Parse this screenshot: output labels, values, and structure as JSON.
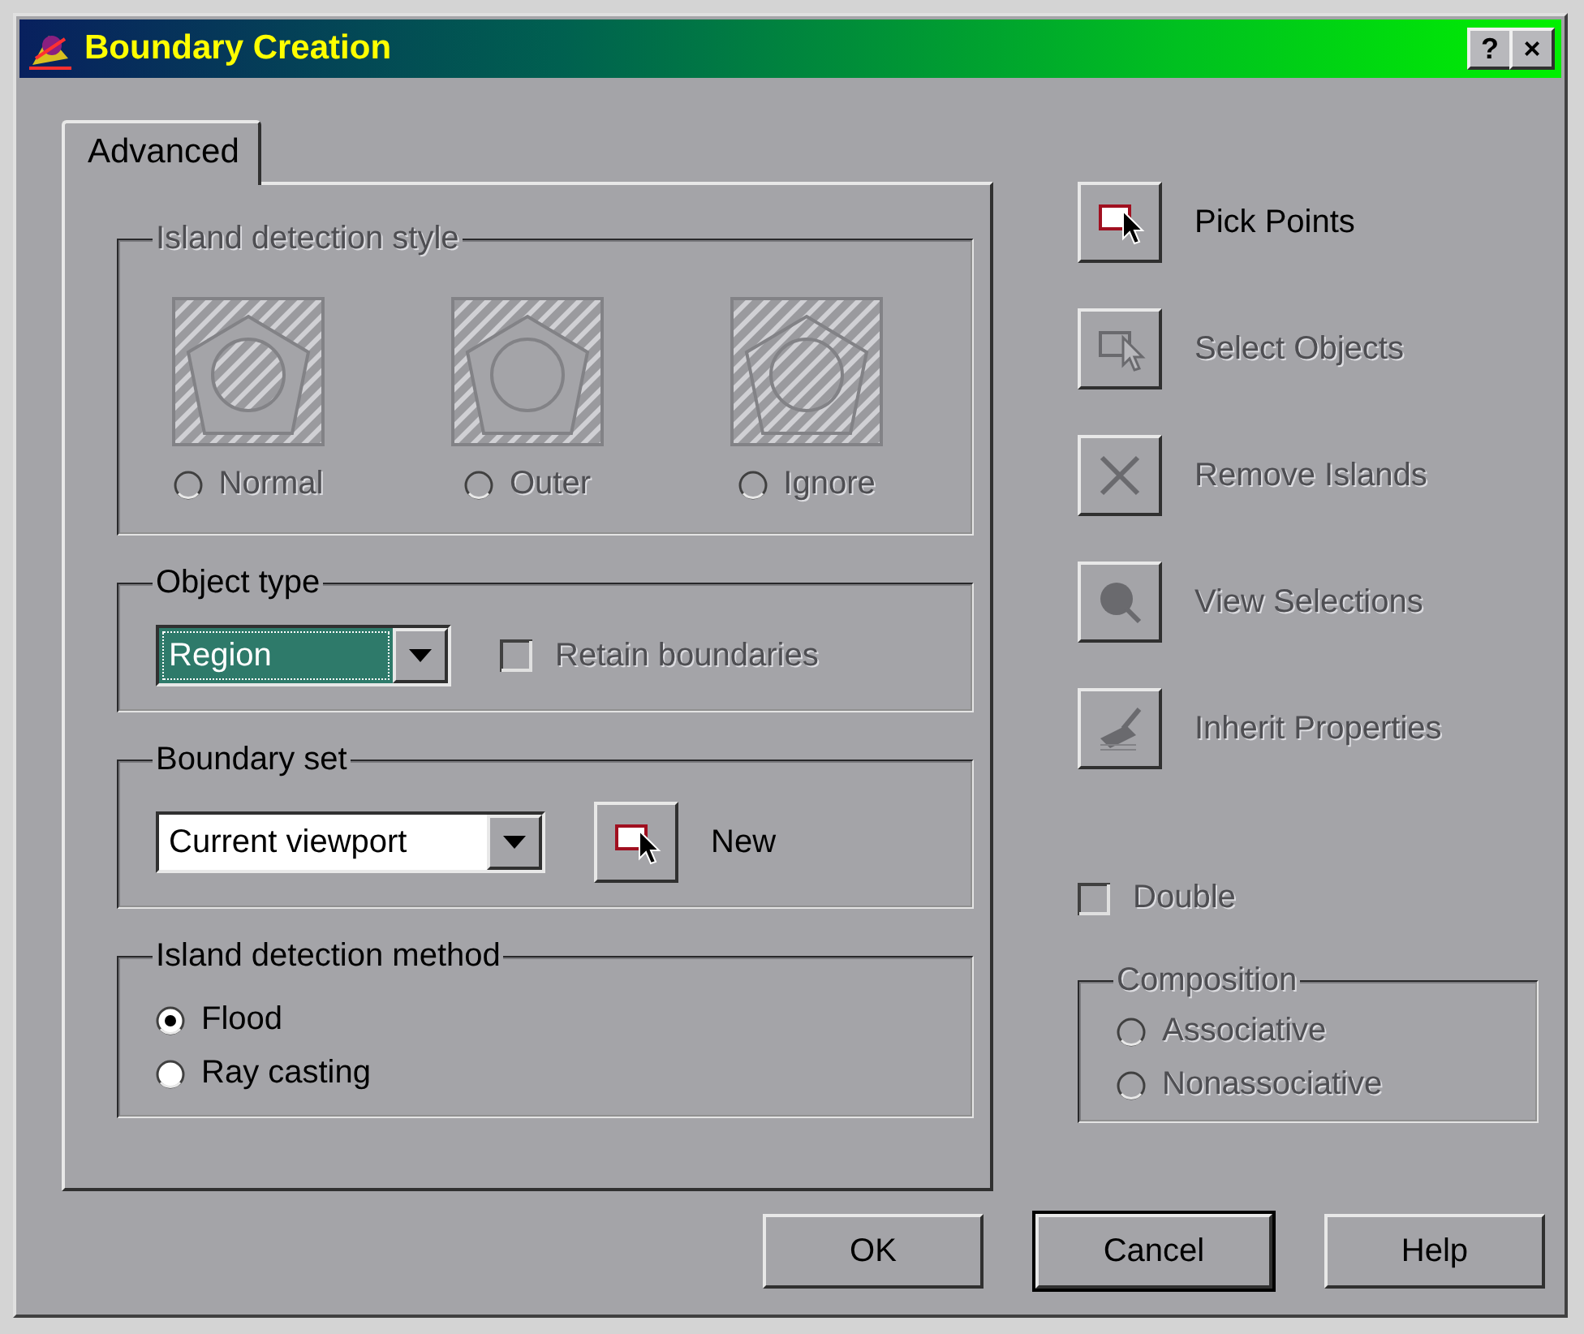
{
  "window": {
    "title": "Boundary Creation",
    "help_button": "?",
    "close_button": "×"
  },
  "tabs": [
    {
      "label": "Advanced",
      "selected": true
    }
  ],
  "island_detection_style": {
    "title": "Island detection style",
    "disabled": true,
    "options": [
      {
        "kind": "normal",
        "label": "Normal",
        "selected": false
      },
      {
        "kind": "outer",
        "label": "Outer",
        "selected": false
      },
      {
        "kind": "ignore",
        "label": "Ignore",
        "selected": false
      }
    ]
  },
  "object_type": {
    "title": "Object type",
    "dropdown": {
      "value": "Region",
      "focused": true
    },
    "retain_boundaries": {
      "label": "Retain boundaries",
      "checked": false,
      "disabled": true
    }
  },
  "boundary_set": {
    "title": "Boundary set",
    "dropdown": {
      "value": "Current viewport",
      "focused": false
    },
    "new_label": "New"
  },
  "island_detection_method": {
    "title": "Island detection method",
    "disabled": false,
    "options": [
      {
        "label": "Flood",
        "selected": true
      },
      {
        "label": "Ray casting",
        "selected": false
      }
    ]
  },
  "actions": [
    {
      "kind": "pick",
      "label": "Pick Points",
      "disabled": false
    },
    {
      "kind": "select",
      "label": "Select Objects",
      "disabled": true
    },
    {
      "kind": "remove",
      "label": "Remove Islands",
      "disabled": true
    },
    {
      "kind": "view",
      "label": "View Selections",
      "disabled": true
    },
    {
      "kind": "inherit",
      "label": "Inherit Properties",
      "disabled": true
    }
  ],
  "double": {
    "label": "Double",
    "checked": false,
    "disabled": true
  },
  "composition": {
    "title": "Composition",
    "disabled": true,
    "options": [
      {
        "label": "Associative",
        "selected": false
      },
      {
        "label": "Nonassociative",
        "selected": false
      }
    ]
  },
  "buttons": [
    {
      "label": "OK",
      "default": false
    },
    {
      "label": "Cancel",
      "default": true
    },
    {
      "label": "Help",
      "default": false
    }
  ]
}
